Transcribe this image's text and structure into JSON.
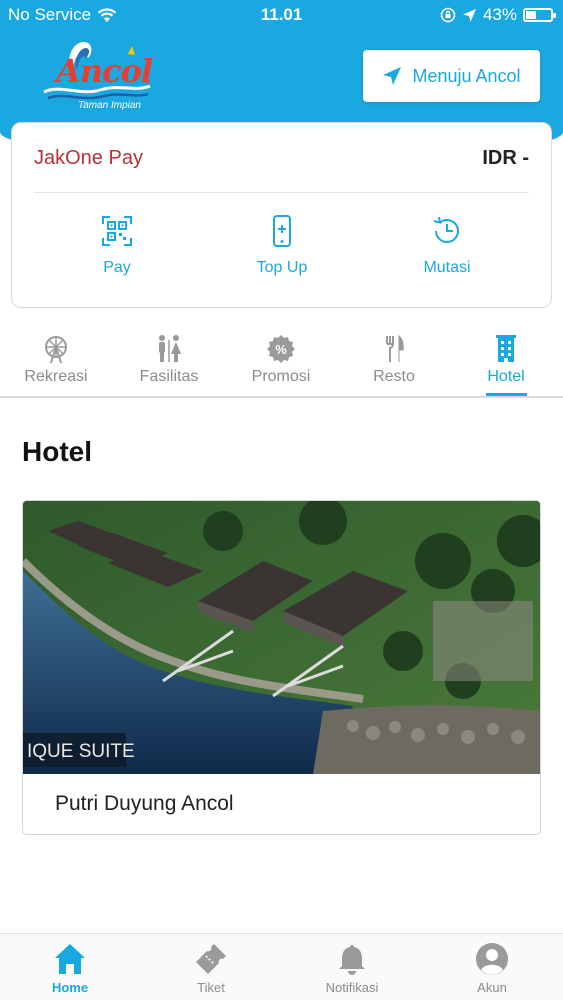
{
  "status_bar": {
    "carrier": "No Service",
    "time": "11.01",
    "battery": "43%",
    "battery_level": 0.43
  },
  "header": {
    "logo_word": "Ancol",
    "logo_subtitle": "Taman Impian",
    "menuju_label": "Menuju Ancol"
  },
  "wallet": {
    "title": "JakOne Pay",
    "balance": "IDR -",
    "actions": [
      {
        "label": "Pay",
        "icon": "qr-code-icon"
      },
      {
        "label": "Top Up",
        "icon": "phone-topup-icon"
      },
      {
        "label": "Mutasi",
        "icon": "history-clock-icon"
      }
    ]
  },
  "tabs": [
    {
      "label": "Rekreasi",
      "icon": "ferris-wheel-icon"
    },
    {
      "label": "Fasilitas",
      "icon": "restroom-icon"
    },
    {
      "label": "Promosi",
      "icon": "percent-badge-icon"
    },
    {
      "label": "Resto",
      "icon": "cutlery-icon"
    },
    {
      "label": "Hotel",
      "icon": "building-icon",
      "active": true
    }
  ],
  "main": {
    "section_title": "Hotel",
    "hotels": [
      {
        "name": "Putri Duyung Ancol",
        "photo_caption": "IQUE SUITE"
      }
    ]
  },
  "bottom_nav": [
    {
      "label": "Home",
      "icon": "home-icon",
      "active": true
    },
    {
      "label": "Tiket",
      "icon": "ticket-icon"
    },
    {
      "label": "Notifikasi",
      "icon": "bell-icon"
    },
    {
      "label": "Akun",
      "icon": "account-icon"
    }
  ],
  "colors": {
    "primary": "#1aa8e0",
    "wallet_title": "#b5323b",
    "inactive": "#8c8c8c"
  }
}
